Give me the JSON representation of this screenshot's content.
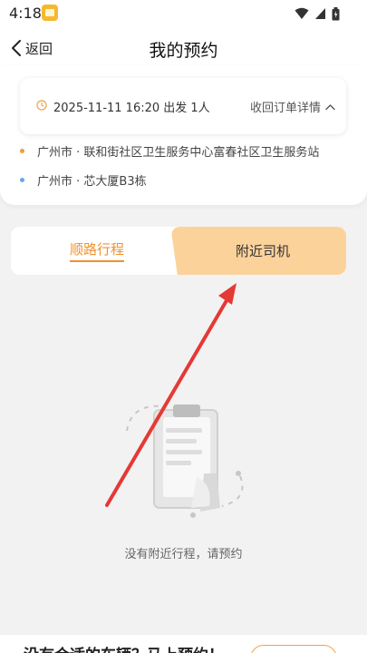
{
  "status_bar": {
    "time": "4:18"
  },
  "nav": {
    "back_label": "返回",
    "title": "我的预约"
  },
  "order": {
    "time_summary": "2025-11-11 16:20 出发 1人",
    "collapse_label": "收回订单详情",
    "origin": "广州市 · 联和街社区卫生服务中心富春社区卫生服务站",
    "destination": "广州市 · 芯大厦B3栋",
    "origin_dot_color": "#f39a3c",
    "destination_dot_color": "#6aa6ee"
  },
  "tabs": [
    {
      "label": "顺路行程",
      "active": false
    },
    {
      "label": "附近司机",
      "active": true
    }
  ],
  "empty_state": {
    "message": "没有附近行程，请预约"
  },
  "bottom": {
    "prompt": "没有合适的车辆？马上预约！"
  },
  "colors": {
    "accent": "#f0922b",
    "tab_highlight": "#fcd29b",
    "arrow": "#e53935"
  },
  "icons": [
    "wifi-icon",
    "signal-icon",
    "battery-icon",
    "back-chevron-icon",
    "clock-icon",
    "chevron-up-icon",
    "clipboard-illustration"
  ]
}
